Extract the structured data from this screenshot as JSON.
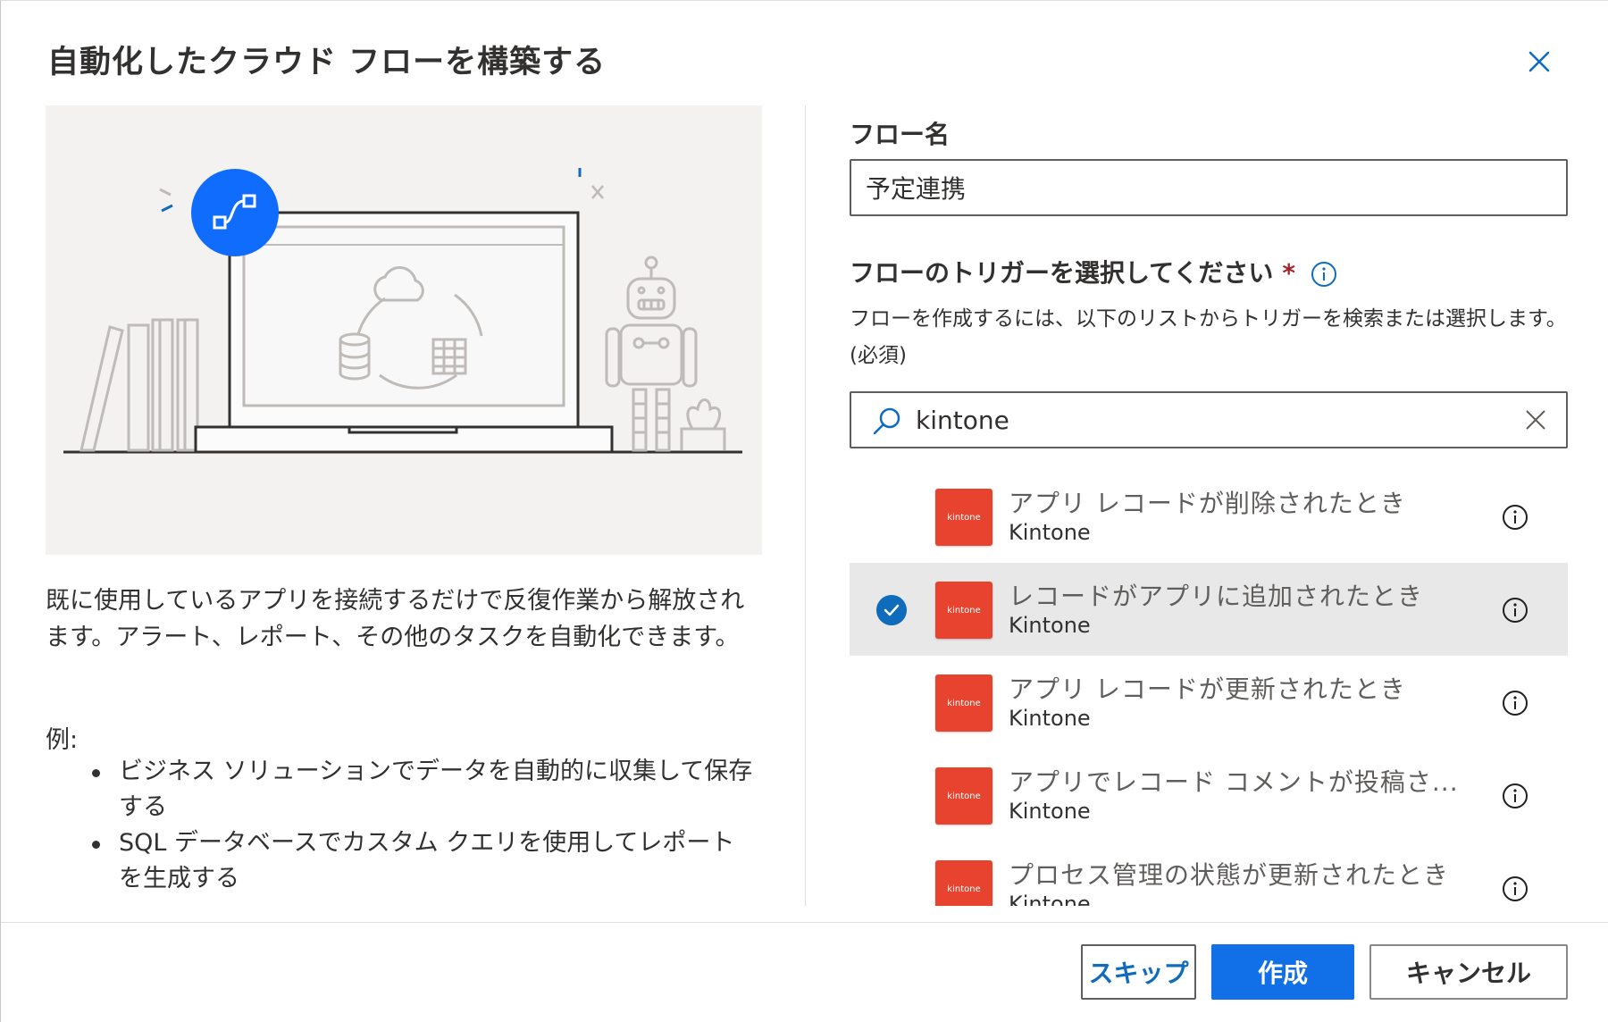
{
  "dialog": {
    "title": "自動化したクラウド フローを構築する"
  },
  "left": {
    "description": "既に使用しているアプリを接続するだけで反復作業から解放されます。アラート、レポート、その他のタスクを自動化できます。",
    "examples_label": "例:",
    "examples": [
      "ビジネス ソリューションでデータを自動的に収集して保存する",
      "SQL データベースでカスタム クエリを使用してレポートを生成する"
    ]
  },
  "form": {
    "flow_name_label": "フロー名",
    "flow_name_value": "予定連携",
    "trigger_label": "フローのトリガーを選択してください",
    "required_mark": "*",
    "hint": "フローを作成するには、以下のリストからトリガーを検索または選択します。(必須)",
    "search_value": "kintone"
  },
  "triggers": [
    {
      "name": "アプリ レコードが削除されたとき",
      "connector": "Kintone",
      "logo_text": "kintone",
      "selected": false
    },
    {
      "name": "レコードがアプリに追加されたとき",
      "connector": "Kintone",
      "logo_text": "kintone",
      "selected": true
    },
    {
      "name": "アプリ レコードが更新されたとき",
      "connector": "Kintone",
      "logo_text": "kintone",
      "selected": false
    },
    {
      "name": "アプリでレコード コメントが投稿さ...",
      "connector": "Kintone",
      "logo_text": "kintone",
      "selected": false
    },
    {
      "name": "プロセス管理の状態が更新されたとき",
      "connector": "Kintone",
      "logo_text": "kintone",
      "selected": false
    }
  ],
  "footer": {
    "skip_label": "スキップ",
    "create_label": "作成",
    "cancel_label": "キャンセル"
  },
  "colors": {
    "accent": "#0f6cbd",
    "kintone_brand": "#e8432f",
    "selected_row": "#e8e8e8"
  }
}
